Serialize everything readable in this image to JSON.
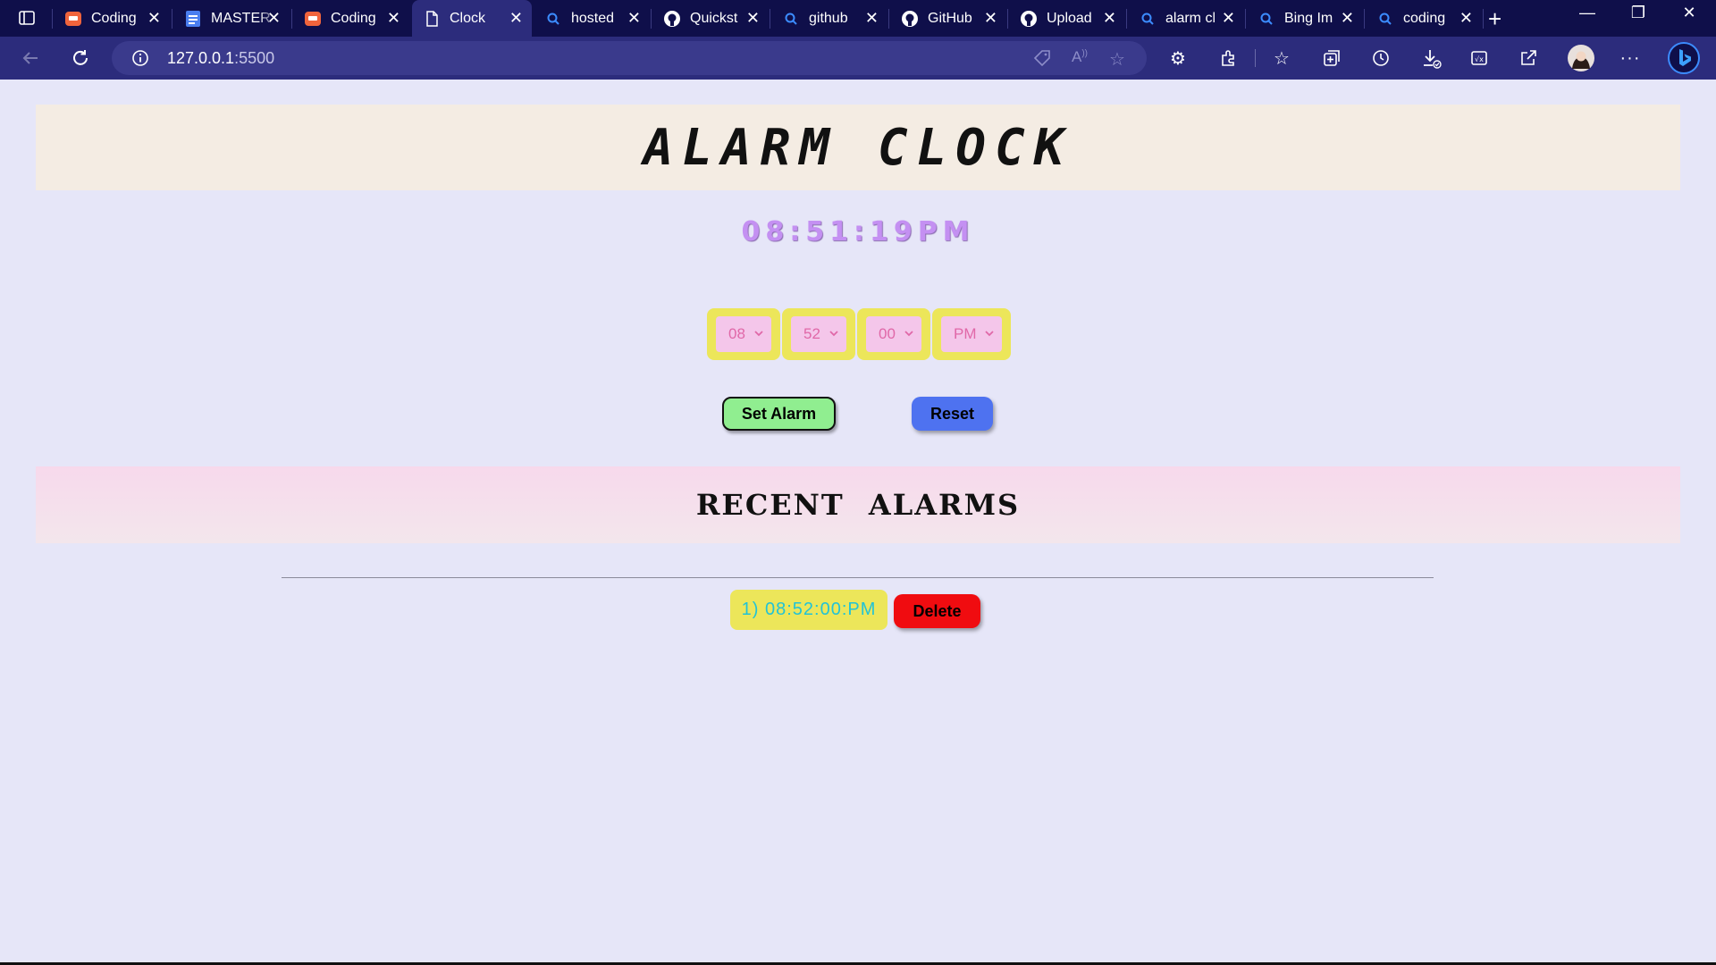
{
  "browser": {
    "tabs": [
      {
        "label": "Coding",
        "icon": "coding-favicon",
        "active": false
      },
      {
        "label": "MASTER",
        "icon": "doc-favicon",
        "active": false
      },
      {
        "label": "Coding",
        "icon": "coding-favicon",
        "active": false
      },
      {
        "label": "Clock",
        "icon": "page-favicon",
        "active": true
      },
      {
        "label": "hosted",
        "icon": "search-favicon",
        "active": false
      },
      {
        "label": "Quickst",
        "icon": "github-favicon",
        "active": false
      },
      {
        "label": "github",
        "icon": "search-favicon",
        "active": false
      },
      {
        "label": "GitHub",
        "icon": "github-favicon",
        "active": false
      },
      {
        "label": "Upload",
        "icon": "github-favicon",
        "active": false
      },
      {
        "label": "alarm cl",
        "icon": "search-favicon",
        "active": false
      },
      {
        "label": "Bing Im",
        "icon": "search-favicon",
        "active": false
      },
      {
        "label": "coding",
        "icon": "search-favicon",
        "active": false
      }
    ],
    "address": {
      "host": "127.0.0.1",
      "port": ":5500"
    },
    "colors": {
      "tabbar": "#0f0f4a",
      "toolbar": "#2c2c7c"
    }
  },
  "app": {
    "title": "ALARM CLOCK",
    "current_time": "08:51:19PM",
    "selectors": {
      "hour": "08",
      "minute": "52",
      "second": "00",
      "ampm": "PM"
    },
    "buttons": {
      "set_alarm": "Set Alarm",
      "reset": "Reset",
      "delete": "Delete"
    },
    "recent_title": "RECENT ALARMS",
    "alarms": [
      {
        "label": "1) 08:52:00:PM"
      }
    ],
    "colors": {
      "background": "#e6e6f8",
      "clock_text": "#c490f2",
      "selector_frame": "#ece65a",
      "selector_fill": "#f4c6ea",
      "set_button": "#90ee90",
      "reset_button": "#4e72f0",
      "delete_button": "#f00c10",
      "alarm_text": "#22c3d6"
    }
  }
}
